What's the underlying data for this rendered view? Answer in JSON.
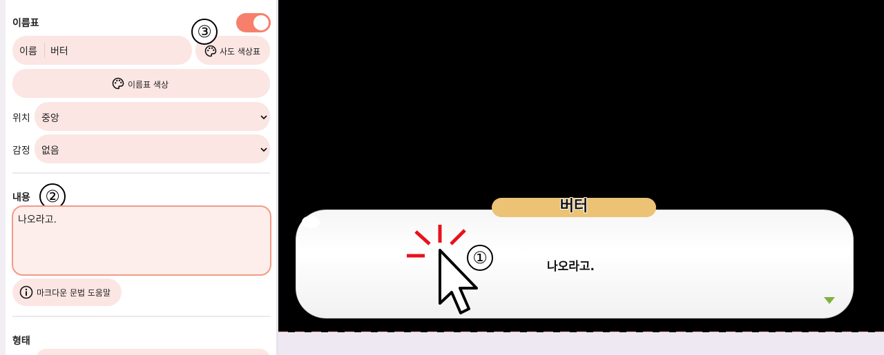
{
  "nameplate_section": {
    "title": "이름표",
    "toggle_on": true,
    "name_label": "이름",
    "name_value": "버터",
    "preset_palette_label": "사도 색상표",
    "nameplate_color_label": "이름표 색상",
    "position_label": "위치",
    "position_value": "중앙",
    "emotion_label": "감정",
    "emotion_value": "없음"
  },
  "content_section": {
    "title": "내용",
    "text_value": "나오라고.",
    "markdown_help_label": "마크다운 문법 도움말"
  },
  "shape_section": {
    "title": "형태"
  },
  "annotations": {
    "marker_1": "①",
    "marker_2": "②",
    "marker_3": "③"
  },
  "preview": {
    "speaker_name": "버터",
    "dialog_text": "나오라고.",
    "nameplate_color": "#ecc274",
    "next_indicator_color": "#7fb23f"
  },
  "colors": {
    "accent": "#f6806b",
    "field_bg": "#fbe6e3",
    "textarea_border": "#f29a85"
  }
}
